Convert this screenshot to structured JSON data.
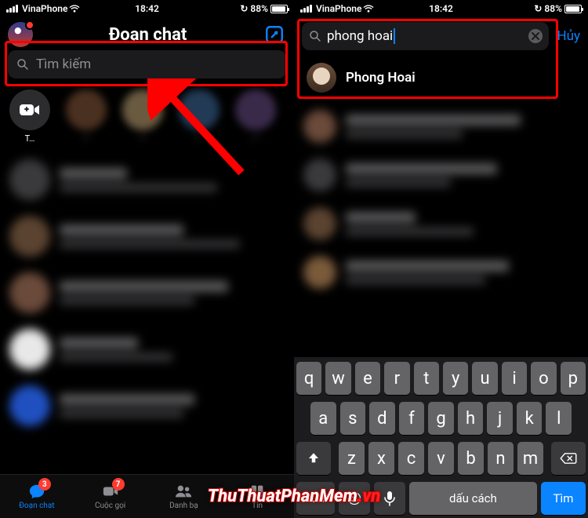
{
  "status": {
    "carrier": "VinaPhone",
    "time": "18:42",
    "battery_pct": "88%",
    "charging_glyph": "↻"
  },
  "left": {
    "header_title": "Đoạn chat",
    "search_placeholder": "Tìm kiếm",
    "story_new_label": "T…",
    "tabs": {
      "chats": {
        "label": "Đoạn chat",
        "badge": "3"
      },
      "calls": {
        "label": "Cuộc gọi",
        "badge": "7"
      },
      "people": {
        "label": "Danh bạ"
      },
      "news": {
        "label": "Tin"
      }
    }
  },
  "right": {
    "search_value": "phong hoai",
    "cancel_label": "Hủy",
    "result_name": "Phong Hoai",
    "keyboard": {
      "row1": [
        "q",
        "w",
        "e",
        "r",
        "t",
        "y",
        "u",
        "i",
        "o",
        "p"
      ],
      "row2": [
        "a",
        "s",
        "d",
        "f",
        "g",
        "h",
        "j",
        "k",
        "l"
      ],
      "row3": [
        "z",
        "x",
        "c",
        "v",
        "b",
        "n",
        "m"
      ],
      "num_label": "123",
      "space_label": "dấu cách",
      "search_label": "Tìm"
    }
  },
  "watermark": {
    "main": "ThuThuatPhanMem",
    "suffix": ".vn"
  }
}
